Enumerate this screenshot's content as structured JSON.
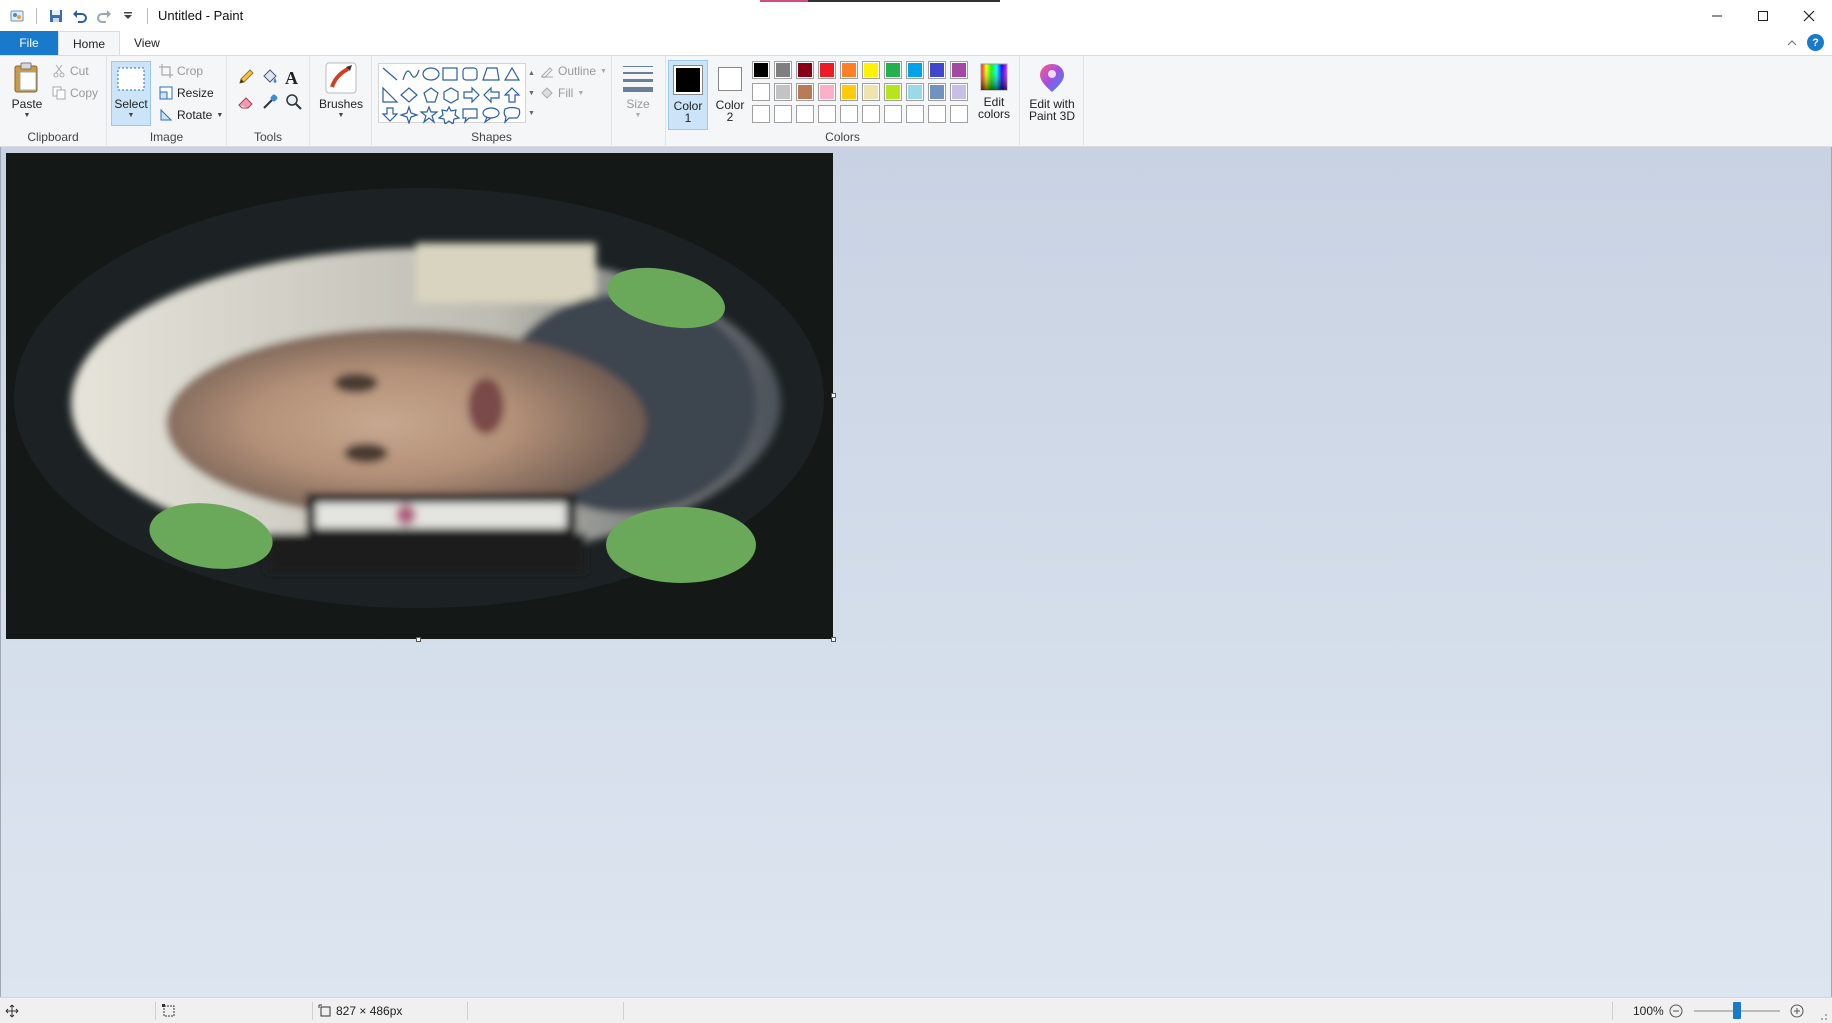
{
  "window": {
    "title": "Untitled - Paint"
  },
  "tabs": {
    "file": "File",
    "home": "Home",
    "view": "View"
  },
  "clipboard": {
    "paste": "Paste",
    "cut": "Cut",
    "copy": "Copy",
    "group_label": "Clipboard"
  },
  "image": {
    "select": "Select",
    "crop": "Crop",
    "resize": "Resize",
    "rotate": "Rotate",
    "group_label": "Image"
  },
  "tools": {
    "group_label": "Tools"
  },
  "brushes": {
    "label": "Brushes"
  },
  "shapes": {
    "outline": "Outline",
    "fill": "Fill",
    "group_label": "Shapes"
  },
  "size": {
    "label": "Size"
  },
  "colors": {
    "color1_line1": "Color",
    "color1_line2": "1",
    "color2_line1": "Color",
    "color2_line2": "2",
    "edit_line1": "Edit",
    "edit_line2": "colors",
    "group_label": "Colors",
    "color1_value": "#000000",
    "color2_value": "#ffffff",
    "palette_row1": [
      "#000000",
      "#7f7f7f",
      "#880015",
      "#ed1c24",
      "#ff7f27",
      "#fff200",
      "#22b14c",
      "#00a2e8",
      "#3f48cc",
      "#a349a4"
    ],
    "palette_row2": [
      "#ffffff",
      "#c3c3c3",
      "#b97a57",
      "#ffaec9",
      "#ffc90e",
      "#efe4b0",
      "#b5e61d",
      "#99d9ea",
      "#7092be",
      "#c8bfe7"
    ],
    "palette_row3": [
      "#ffffff",
      "#ffffff",
      "#ffffff",
      "#ffffff",
      "#ffffff",
      "#ffffff",
      "#ffffff",
      "#ffffff",
      "#ffffff",
      "#ffffff"
    ]
  },
  "paint3d": {
    "line1": "Edit with",
    "line2": "Paint 3D"
  },
  "status": {
    "image_size": "827 × 486px",
    "zoom": "100%"
  }
}
